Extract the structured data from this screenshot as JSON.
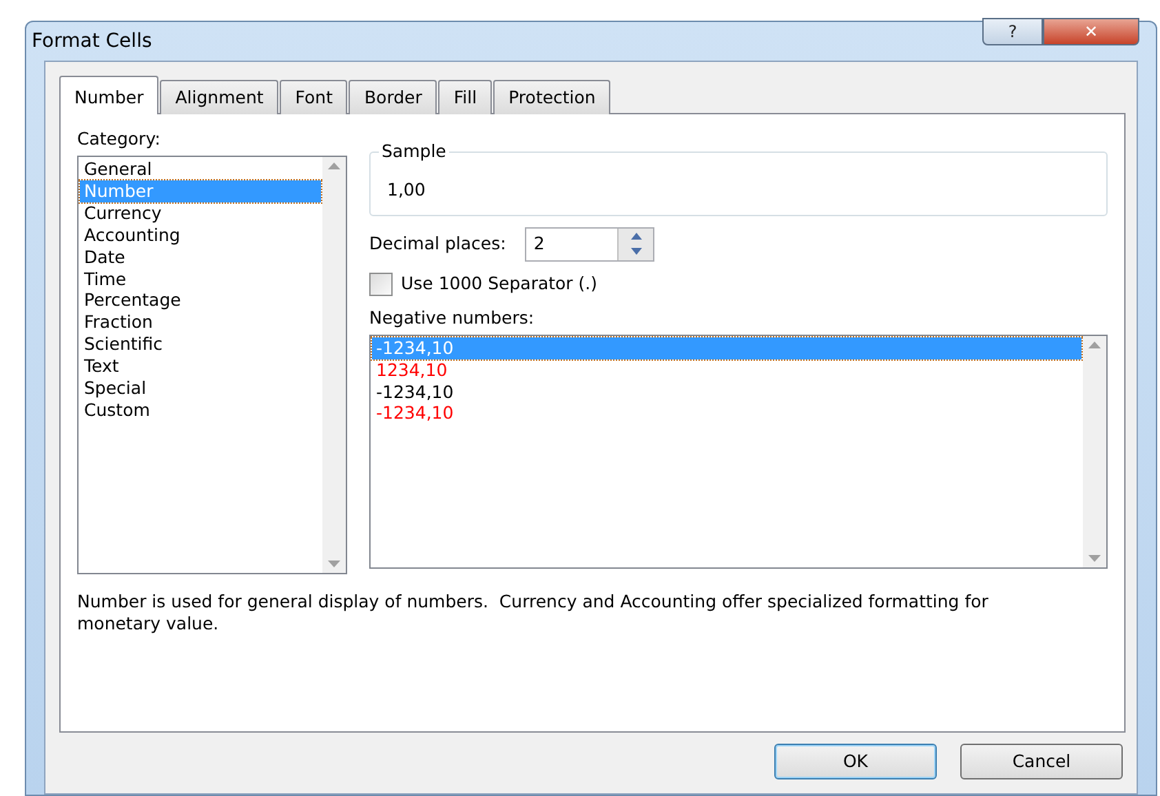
{
  "window": {
    "title": "Format Cells",
    "controls": [
      "?",
      "✕"
    ]
  },
  "tabs": [
    {
      "label": "Number",
      "selected": true
    },
    {
      "label": "Alignment",
      "selected": false
    },
    {
      "label": "Font",
      "selected": false
    },
    {
      "label": "Border",
      "selected": false
    },
    {
      "label": "Fill",
      "selected": false
    },
    {
      "label": "Protection",
      "selected": false
    }
  ],
  "category": {
    "label": "Category:",
    "items": [
      {
        "label": "General",
        "selected": false
      },
      {
        "label": "Number",
        "selected": true
      },
      {
        "label": "Currency",
        "selected": false
      },
      {
        "label": "Accounting",
        "selected": false
      },
      {
        "label": "Date",
        "selected": false
      },
      {
        "label": "Time",
        "selected": false
      },
      {
        "label": "Percentage",
        "selected": false
      },
      {
        "label": "Fraction",
        "selected": false
      },
      {
        "label": "Scientific",
        "selected": false
      },
      {
        "label": "Text",
        "selected": false
      },
      {
        "label": "Special",
        "selected": false
      },
      {
        "label": "Custom",
        "selected": false
      }
    ]
  },
  "sample": {
    "label": "Sample",
    "value": "1,00"
  },
  "decimal_places": {
    "label": "Decimal places:",
    "value": "2"
  },
  "separator": {
    "label": "Use 1000 Separator (.)",
    "checked": false
  },
  "negative_numbers": {
    "label": "Negative numbers:",
    "items": [
      {
        "label": "-1234,10",
        "selected": true
      },
      {
        "label": "1234,10",
        "selected": false,
        "color": "#ff0000"
      },
      {
        "label": "-1234,10",
        "selected": false,
        "color": "#000000"
      },
      {
        "label": "-1234,10",
        "selected": false,
        "color": "#ff0000"
      }
    ]
  },
  "description": "Number is used for general display of numbers.  Currency and Accounting offer specialized formatting for monetary value.",
  "buttons": [
    {
      "label": "OK",
      "default": true
    },
    {
      "label": "Cancel",
      "default": false
    }
  ]
}
